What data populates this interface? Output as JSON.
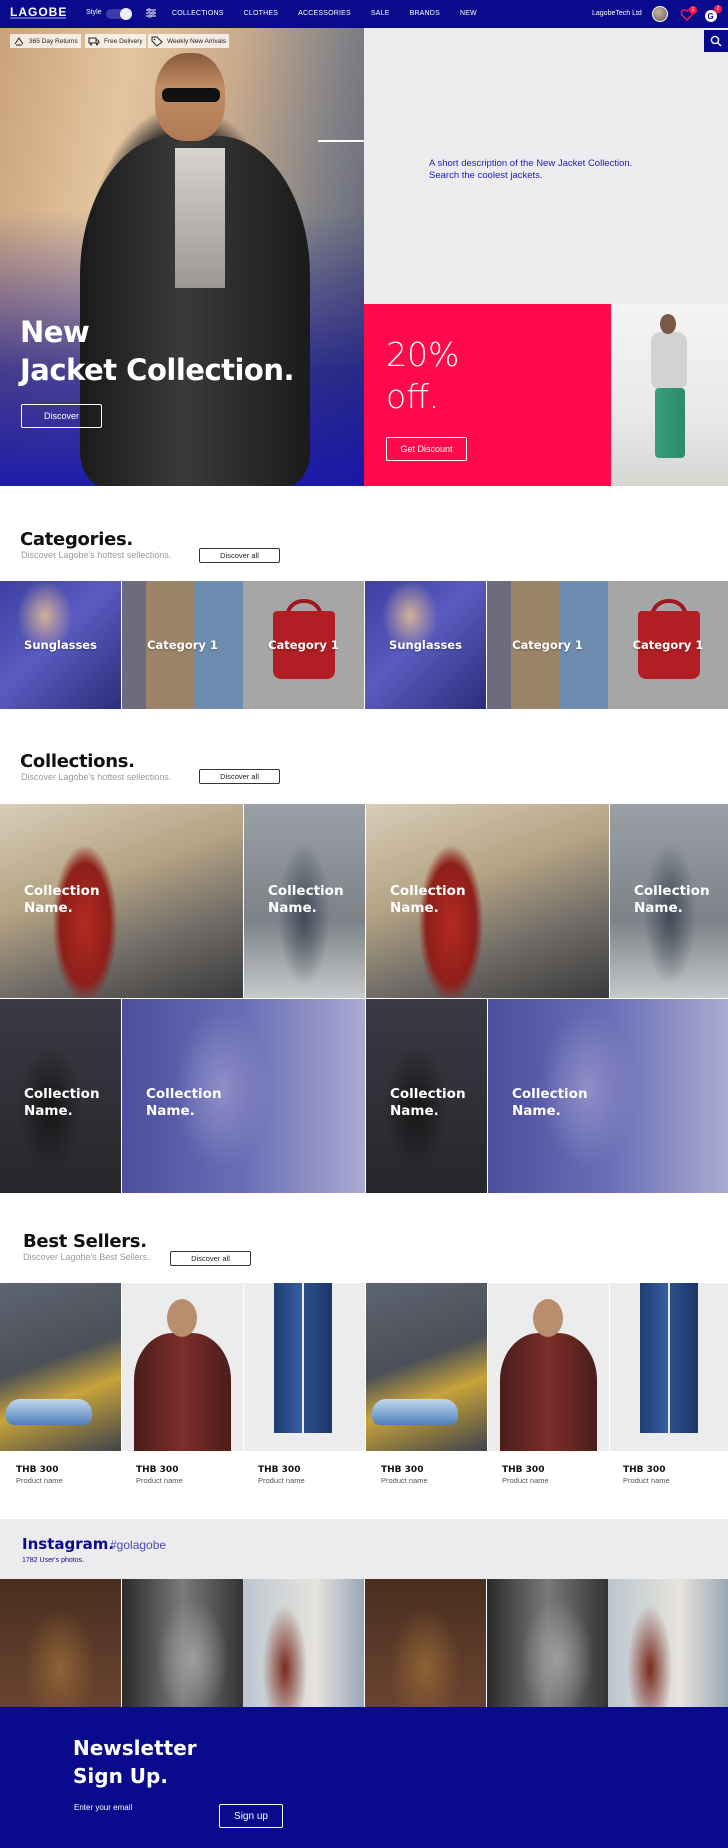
{
  "nav": {
    "logo": "LAGOBE",
    "style_label": "Style",
    "links": [
      "COLLECTIONS",
      "CLOTHES",
      "ACCESSORIES",
      "SALE",
      "BRANDS",
      "NEW"
    ],
    "account": "LagobeTech Ltd",
    "wishlist_count": "1",
    "cart_count": "2"
  },
  "usps": [
    "365 Day Returns",
    "Free Delivery",
    "Weekly New Arrivals"
  ],
  "hero": {
    "title_line1": "New",
    "title_line2": "Jacket Collection.",
    "button": "Discover",
    "description_line1": "A short description of the New Jacket Collection.",
    "description_line2": "Search the coolest jackets."
  },
  "promo": {
    "line1": "20%",
    "line2": "off.",
    "button": "Get Discount"
  },
  "categories": {
    "title": "Categories.",
    "subtitle": "Discover Lagobe's hottest sellections.",
    "button": "Discover all",
    "items": [
      "Sunglasses",
      "Category 1",
      "Category 1",
      "Sunglasses",
      "Category 1",
      "Category 1"
    ]
  },
  "collections": {
    "title": "Collections.",
    "subtitle": "Discover Lagobe's hottest sellections.",
    "button": "Discover all",
    "item_line1": "Collection",
    "item_line2": "Name."
  },
  "best_sellers": {
    "title": "Best Sellers.",
    "subtitle": "Discover Lagobe's Best Sellers.",
    "button": "Discover all",
    "products": [
      {
        "price": "THB 300",
        "name": "Product name"
      },
      {
        "price": "THB 300",
        "name": "Product name"
      },
      {
        "price": "THB 300",
        "name": "Product name"
      },
      {
        "price": "THB 300",
        "name": "Product name"
      },
      {
        "price": "THB 300",
        "name": "Product name"
      },
      {
        "price": "THB 300",
        "name": "Product name"
      }
    ]
  },
  "instagram": {
    "title": "Instagram.",
    "tag": "#golagobe",
    "count": "1782 User's photos."
  },
  "newsletter": {
    "title_line1": "Newsletter",
    "title_line2": "Sign Up.",
    "placeholder": "Enter your email",
    "button": "Sign up"
  },
  "colors": {
    "brand": "#0a0a8c",
    "accent": "#ff0a4a"
  }
}
